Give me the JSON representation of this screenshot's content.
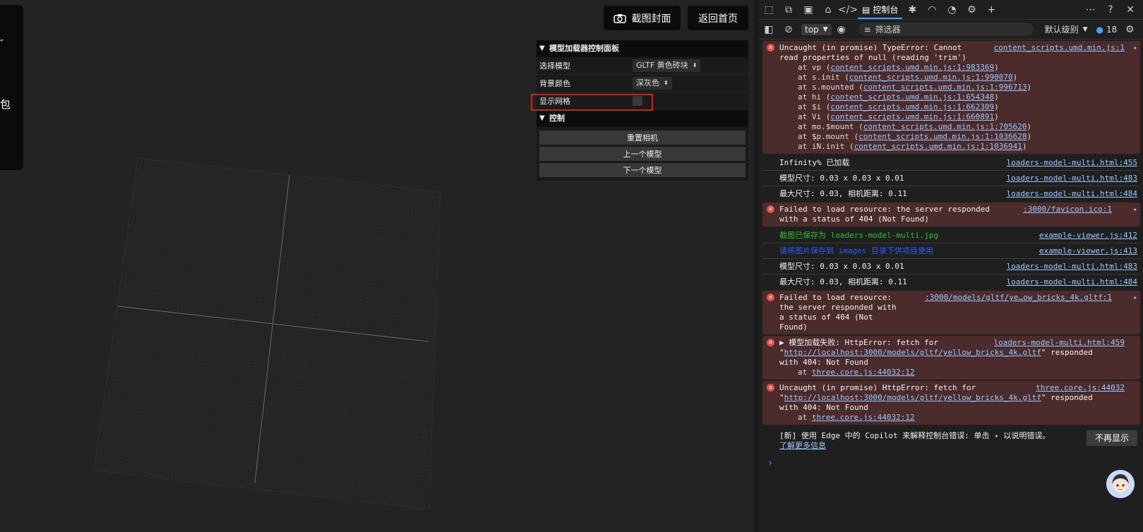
{
  "viewer": {
    "info_chars": [
      "″",
      "包"
    ],
    "cover_button": "截图封面",
    "home_button": "返回首页"
  },
  "gui": {
    "panel_title": "模型加载器控制面板",
    "model_label": "选择模型",
    "model_value": "GLTF 黄色砖块",
    "bg_label": "背景颜色",
    "bg_value": "深灰色",
    "grid_label": "显示网格",
    "grid_checked": false,
    "control_title": "控制",
    "buttons": [
      "重置相机",
      "上一个模型",
      "下一个模型"
    ]
  },
  "devtools": {
    "active_tab": "控制台",
    "context": "top",
    "filter_placeholder": "筛选器",
    "level": "默认级别",
    "issue_count": "18",
    "messages": [
      {
        "type": "error",
        "text": "Uncaught (in promise) TypeError: Cannot read properties of null (reading 'trim')",
        "source": "content_scripts.umd.min.js:1",
        "stack": [
          {
            "fn": "at vp (",
            "link": "content_scripts.umd.min.js:1:983369"
          },
          {
            "fn": "at s.init (",
            "link": "content_scripts.umd.min.js:1:990070"
          },
          {
            "fn": "at s.mounted (",
            "link": "content_scripts.umd.min.js:1:996713"
          },
          {
            "fn": "at hi (",
            "link": "content_scripts.umd.min.js:1:654348"
          },
          {
            "fn": "at $i (",
            "link": "content_scripts.umd.min.js:1:662309"
          },
          {
            "fn": "at Vi (",
            "link": "content_scripts.umd.min.js:1:660891"
          },
          {
            "fn": "at mo.$mount (",
            "link": "content_scripts.umd.min.js:1:705620"
          },
          {
            "fn": "at $p.mount (",
            "link": "content_scripts.umd.min.js:1:1036628"
          },
          {
            "fn": "at iN.init (",
            "link": "content_scripts.umd.min.js:1:1036941"
          }
        ]
      },
      {
        "type": "log",
        "text": "Infinity% 已加载",
        "source": "loaders-model-multi.html:455"
      },
      {
        "type": "log",
        "text": "模型尺寸: 0.03 x 0.03 x 0.01",
        "source": "loaders-model-multi.html:483"
      },
      {
        "type": "log",
        "text": "最大尺寸: 0.03, 相机距离: 0.11",
        "source": "loaders-model-multi.html:484"
      },
      {
        "type": "error",
        "text": "Failed to load resource: the server responded with a status of 404 (Not Found)",
        "source": ":3000/favicon.ico:1"
      },
      {
        "type": "log-green",
        "text_a": "截图已保存为",
        "text_b": "loaders-model-multi.jpg",
        "source": "example-viewer.js:412"
      },
      {
        "type": "log-blue",
        "text": "请将图片保存到 images 目录下供项目使用",
        "source": "example-viewer.js:413"
      },
      {
        "type": "log",
        "text": "模型尺寸: 0.03 x 0.03 x 0.01",
        "source": "loaders-model-multi.html:483"
      },
      {
        "type": "log",
        "text": "最大尺寸: 0.03, 相机距离: 0.11",
        "source": "loaders-model-multi.html:484"
      },
      {
        "type": "error",
        "text": "Failed to load resource: the server responded with a status of 404 (Not Found)",
        "source": ":3000/models/gltf/ye…ow_bricks_4k.gltf:1"
      },
      {
        "type": "error",
        "text_pre": "▶ 模型加载失败: HttpError: fetch for \"",
        "url": "http://localhost:3000/models/gltf/yellow_bricks_4k.gltf",
        "text_post": "\" responded with 404: Not Found",
        "at": "at ",
        "at_link": "three.core.js:44032:12",
        "source": "loaders-model-multi.html:459"
      },
      {
        "type": "error",
        "text_pre": "Uncaught (in promise) HttpError: fetch for \"",
        "url": "http://localhost:3000/models/gltf/yellow_bricks_4k.gltf",
        "text_post": "\" responded with 404: Not Found",
        "at": "at ",
        "at_link": "three.core.js:44032:12",
        "source": "three.core.js:44032"
      }
    ],
    "copilot_text": "[新] 使用 Edge 中的 Copilot 来解释控制台错误: 单击",
    "copilot_text2": "以说明错误。",
    "copilot_link": "了解更多信息",
    "dismiss_button": "不再显示"
  }
}
